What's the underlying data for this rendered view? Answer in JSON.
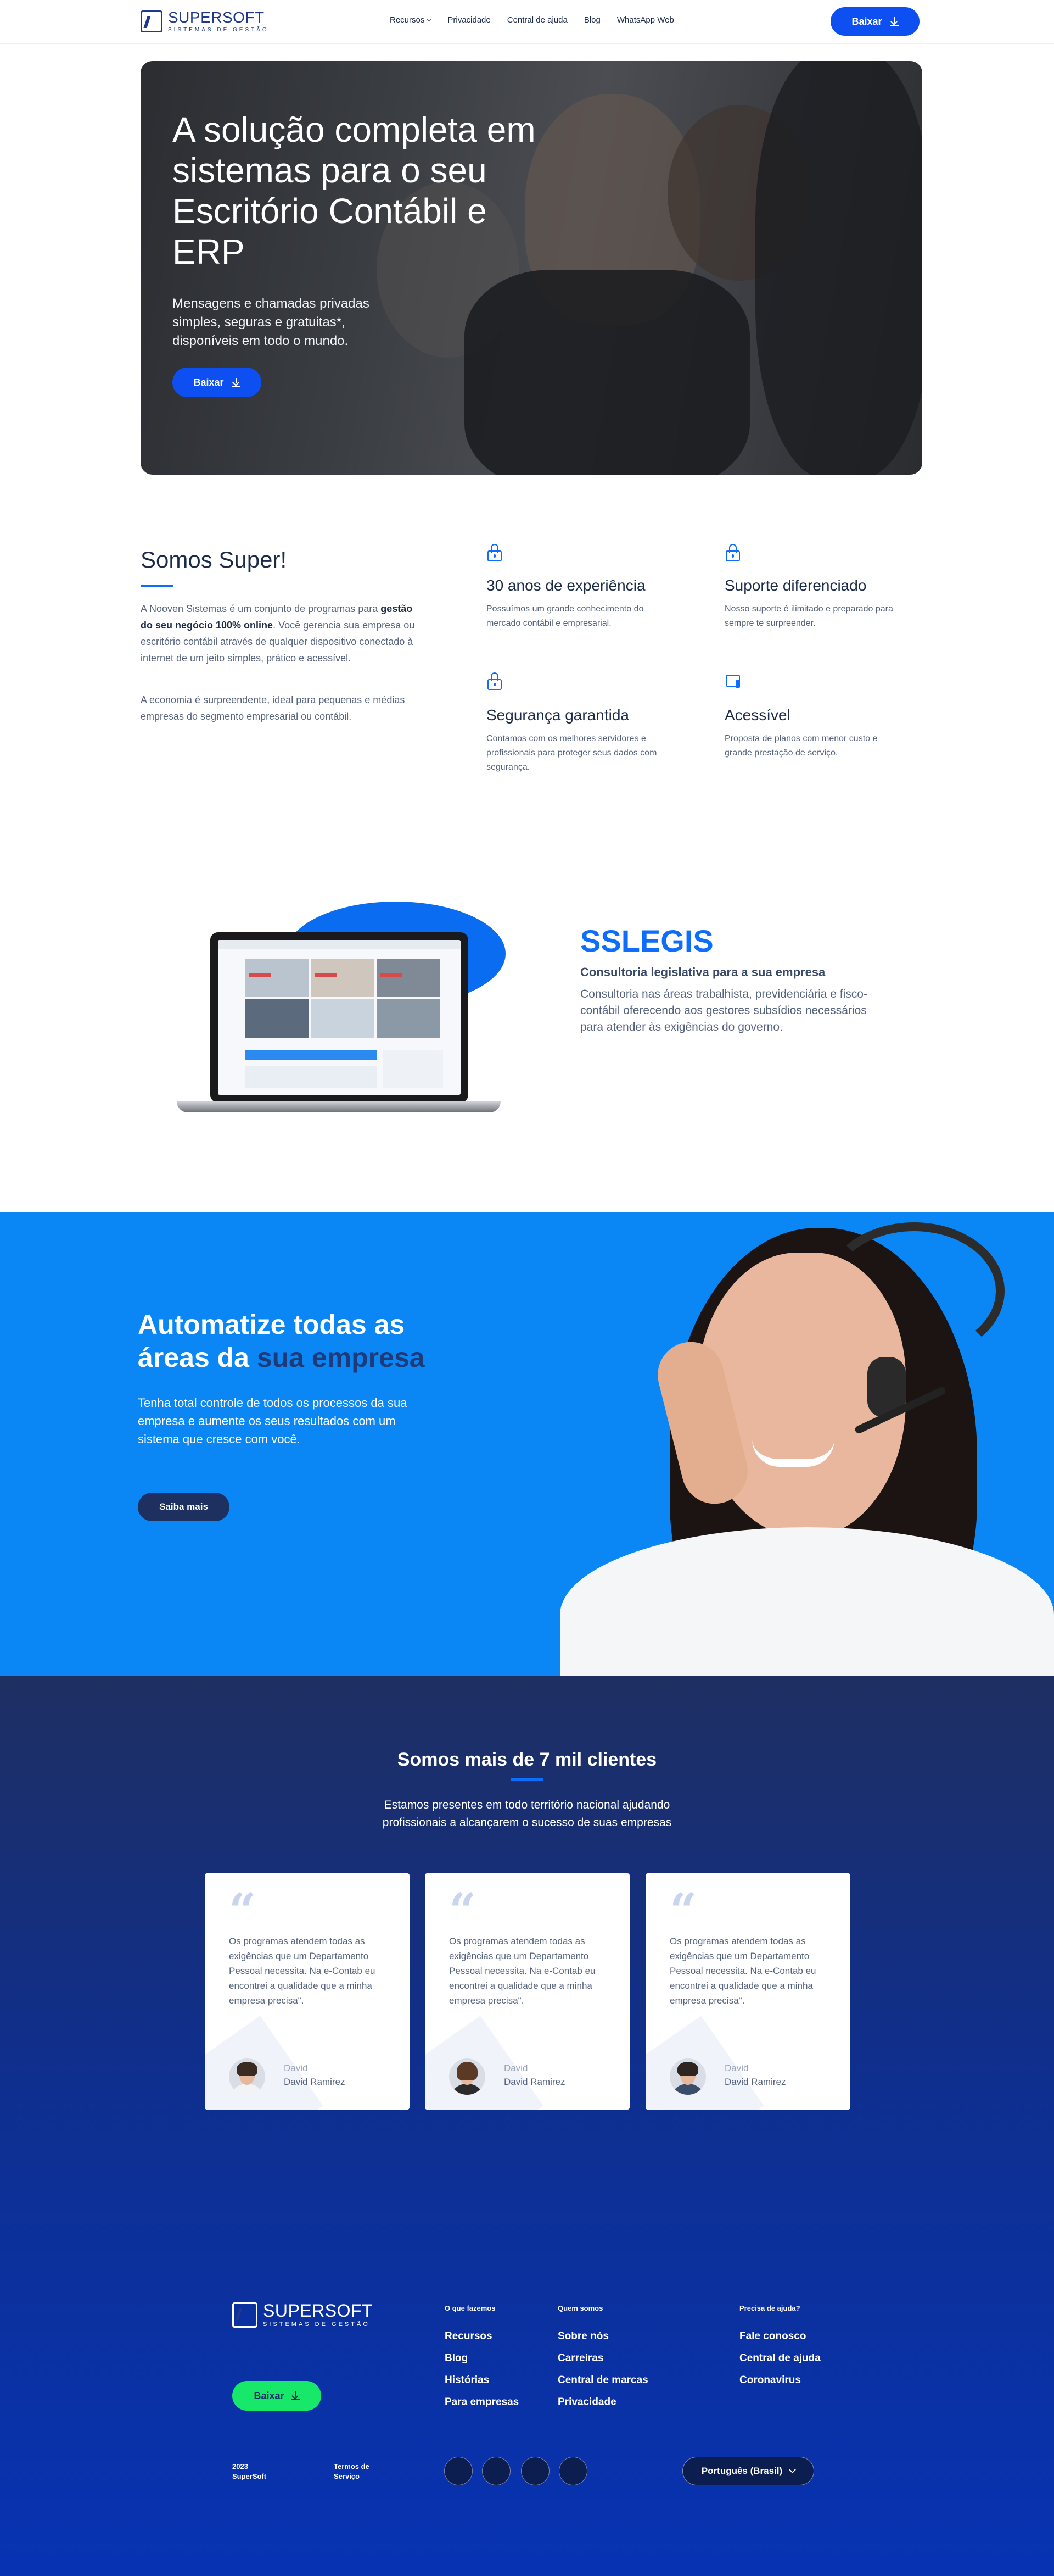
{
  "header": {
    "logo_name": "SUPERSOFT",
    "logo_sub": "SISTEMAS DE GESTÃO",
    "nav": [
      "Recursos",
      "Privacidade",
      "Central de ajuda",
      "Blog",
      "WhatsApp Web"
    ],
    "download_label": "Baixar"
  },
  "hero": {
    "title": "A solução completa em sistemas para o seu Escritório Contábil e ERP",
    "subtitle": "Mensagens e chamadas privadas simples, seguras e gratuitas*, disponíveis em todo o mundo.",
    "download_label": "Baixar"
  },
  "about": {
    "title": "Somos Super!",
    "p1_start": "A Nooven Sistemas é um conjunto de programas para ",
    "p1_bold": "gestão do seu negócio 100% online",
    "p1_end": ". Você gerencia sua empresa ou escritório contábil através de qualquer dispositivo conectado à internet de um jeito simples, prático e acessível.",
    "p2": "A economia é surpreendente, ideal para pequenas e médias empresas do segmento empresarial ou contábil.",
    "features": [
      {
        "icon": "lock-icon",
        "title": "30 anos de experiência",
        "text": "Possuímos um grande conhecimento do mercado contábil e empresarial."
      },
      {
        "icon": "lock-icon",
        "title": "Suporte diferenciado",
        "text": "Nosso suporte é ilimitado e preparado para sempre te surpreender."
      },
      {
        "icon": "lock-icon",
        "title": "Segurança garantida",
        "text": "Contamos com os melhores servidores e profissionais para proteger seus dados com segurança."
      },
      {
        "icon": "devices-icon",
        "title": "Acessível",
        "text": "Proposta de planos com menor custo e grande prestação de serviço."
      }
    ]
  },
  "sslegis": {
    "title": "SSLEGIS",
    "subtitle": "Consultoria legislativa para a sua empresa",
    "text": "Consultoria nas áreas trabalhista, previdenciária e fisco-contábil oferecendo aos gestores subsídios necessários para atender às exigências do governo."
  },
  "automatize": {
    "title_start": "Automatize todas as áreas da ",
    "title_accent": "sua empresa",
    "text": "Tenha total controle de todos os processos da sua empresa e aumente os seus resultados com um sistema que cresce com você.",
    "button_label": "Saiba mais"
  },
  "clients": {
    "title": "Somos mais de 7 mil clientes",
    "subtitle": "Estamos presentes em todo território nacional ajudando profissionais a alcançarem o sucesso de suas empresas",
    "testimonials": [
      {
        "quote": "Os programas atendem todas as exigências que um Departamento Pessoal necessita. Na e-Contab eu encontrei a qualidade que a minha empresa precisa\".",
        "name": "David",
        "role": "David Ramirez"
      },
      {
        "quote": "Os programas atendem todas as exigências que um Departamento Pessoal necessita. Na e-Contab eu encontrei a qualidade que a minha empresa precisa\".",
        "name": "David",
        "role": "David Ramirez"
      },
      {
        "quote": "Os programas atendem todas as exigências que um Departamento Pessoal necessita. Na e-Contab eu encontrei a qualidade que a minha empresa precisa\".",
        "name": "David",
        "role": "David Ramirez"
      }
    ]
  },
  "footer": {
    "logo_name": "SUPERSOFT",
    "logo_sub": "SISTEMAS DE GESTÃO",
    "download_label": "Baixar",
    "col1_title": "O que fazemos",
    "col1_links": [
      "Recursos",
      "Blog",
      "Histórias",
      "Para empresas"
    ],
    "col2_title": "Quem somos",
    "col2_links": [
      "Sobre nós",
      "Carreiras",
      "Central de marcas",
      "Privacidade"
    ],
    "col3_title": "Precisa de ajuda?",
    "col3_links": [
      "Fale conosco",
      "Central de ajuda",
      "Coronavirus"
    ],
    "copyright_year": "2023",
    "copyright_name": "SuperSoft",
    "terms_1": "Termos de",
    "terms_2": "Serviço",
    "language": "Português (Brasil)"
  },
  "colors": {
    "primary": "#0d4ff0",
    "accent_blue": "#0a87f5",
    "navy": "#1e2f62",
    "green": "#17e86a"
  }
}
